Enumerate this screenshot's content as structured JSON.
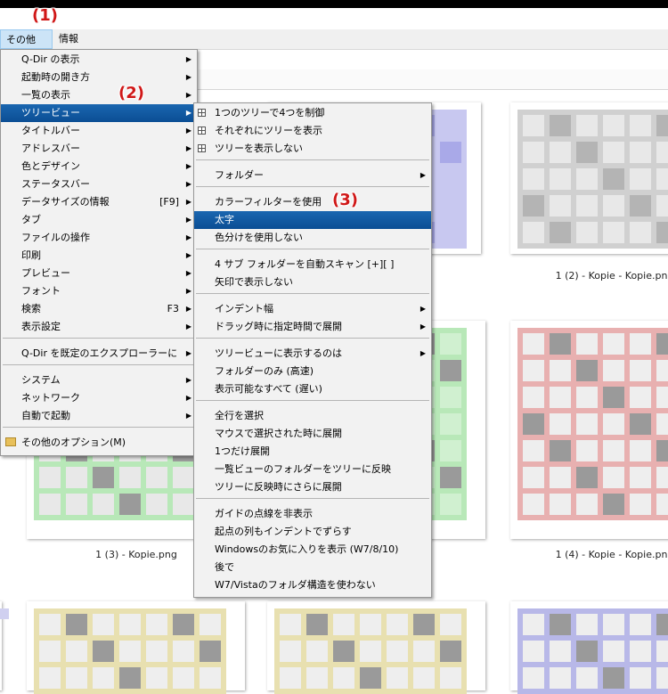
{
  "callouts": [
    "(1)",
    "(2)",
    "(3)"
  ],
  "menubar": {
    "items": [
      "その他(X)",
      "情報"
    ]
  },
  "main_menu": {
    "items": [
      {
        "label": "Q-Dir の表示",
        "shortcut": "",
        "submenu": true
      },
      {
        "label": "起動時の開き方",
        "shortcut": "",
        "submenu": true
      },
      {
        "label": "一覧の表示",
        "shortcut": "",
        "submenu": true
      },
      {
        "label": "ツリービュー",
        "shortcut": "",
        "submenu": true
      },
      {
        "label": "タイトルバー",
        "shortcut": "",
        "submenu": true
      },
      {
        "label": "アドレスバー",
        "shortcut": "",
        "submenu": true
      },
      {
        "label": "色とデザイン",
        "shortcut": "",
        "submenu": true
      },
      {
        "label": "ステータスバー",
        "shortcut": "",
        "submenu": true
      },
      {
        "label": "データサイズの情報",
        "shortcut": "[F9]",
        "submenu": true
      },
      {
        "label": "タブ",
        "shortcut": "",
        "submenu": true
      },
      {
        "label": "ファイルの操作",
        "shortcut": "",
        "submenu": true
      },
      {
        "label": "印刷",
        "shortcut": "",
        "submenu": true
      },
      {
        "label": "プレビュー",
        "shortcut": "",
        "submenu": true
      },
      {
        "label": "フォント",
        "shortcut": "",
        "submenu": true
      },
      {
        "label": "検索",
        "shortcut": "F3",
        "submenu": true
      },
      {
        "label": "表示設定",
        "shortcut": "",
        "submenu": true
      },
      {
        "label": "Q-Dir を既定のエクスプローラーに",
        "shortcut": "",
        "submenu": true
      },
      {
        "label": "システム",
        "shortcut": "",
        "submenu": true
      },
      {
        "label": "ネットワーク",
        "shortcut": "",
        "submenu": true
      },
      {
        "label": "自動で起動",
        "shortcut": "",
        "submenu": true
      },
      {
        "label": "その他のオプション(M)",
        "shortcut": "",
        "submenu": false
      }
    ]
  },
  "tree_menu": {
    "items": [
      "1つのツリーで4つを制御",
      "それぞれにツリーを表示",
      "ツリーを表示しない",
      "フォルダー",
      "カラーフィルターを使用",
      "太字",
      "色分けを使用しない",
      "4 サブ フォルダーを自動スキャン [+][ ]",
      "矢印で表示しない",
      "インデント幅",
      "ドラッグ時に指定時間で展開",
      "ツリービューに表示するのは",
      "フォルダーのみ (高速)",
      "表示可能なすべて (遅い)",
      "全行を選択",
      "マウスで選択された時に展開",
      "1つだけ展開",
      "一覧ビューのフォルダーをツリーに反映",
      "ツリーに反映時にさらに展開",
      "ガイドの点線を非表示",
      "起点の列もインデントでずらす",
      "Windowsのお気に入りを表示 (W7/8/10)",
      "後で",
      "W7/Vistaのフォルダ構造を使わない"
    ]
  },
  "files": [
    "1 (2) - Kopie - Kopie.png",
    "1 (3) - Kopie.png",
    "1 (4) - Kopie - Kopie.png"
  ],
  "colors": {
    "highlight": "#0b4e94",
    "callout": "#d01818"
  }
}
